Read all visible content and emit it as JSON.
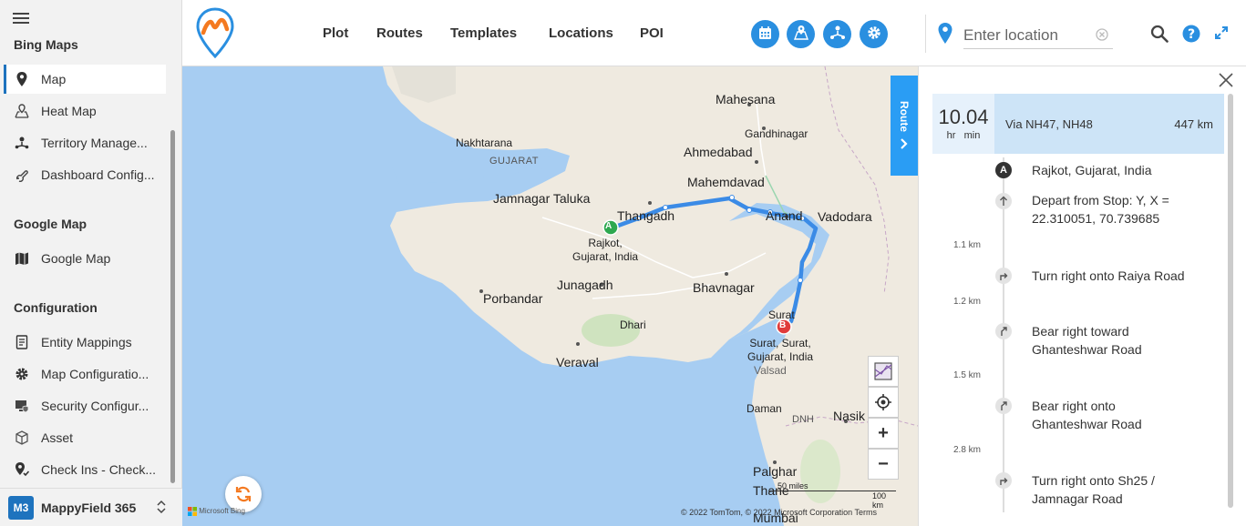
{
  "sidebar": {
    "sections": [
      {
        "title": "Bing Maps"
      },
      {
        "title": "Google Map"
      },
      {
        "title": "Configuration"
      }
    ],
    "items": [
      {
        "label": "Map"
      },
      {
        "label": "Heat Map"
      },
      {
        "label": "Territory Manage..."
      },
      {
        "label": "Dashboard Config..."
      },
      {
        "label": "Google Map"
      },
      {
        "label": "Entity Mappings"
      },
      {
        "label": "Map Configuratio..."
      },
      {
        "label": "Security Configur..."
      },
      {
        "label": "Asset"
      },
      {
        "label": "Check Ins - Check..."
      }
    ],
    "footer": {
      "avatar": "M3",
      "app_name": "MappyField 365"
    }
  },
  "topnav": {
    "items": [
      {
        "label": "Plot"
      },
      {
        "label": "Routes"
      },
      {
        "label": "Templates"
      },
      {
        "label": "Locations"
      },
      {
        "label": "POI"
      }
    ],
    "location_placeholder": "Enter location"
  },
  "map": {
    "cities": [
      {
        "name": "Mahesana"
      },
      {
        "name": "Gandhinagar"
      },
      {
        "name": "Ahmedabad"
      },
      {
        "name": "Nakhtarana"
      },
      {
        "name": "GUJARAT"
      },
      {
        "name": "Mahemdavad"
      },
      {
        "name": "Jamnagar Taluka"
      },
      {
        "name": "Thangadh"
      },
      {
        "name": "Anand"
      },
      {
        "name": "Vadodara"
      },
      {
        "name": "Junagadh"
      },
      {
        "name": "Bhavnagar"
      },
      {
        "name": "Porbandar"
      },
      {
        "name": "Dhari"
      },
      {
        "name": "Surat"
      },
      {
        "name": "Veraval"
      },
      {
        "name": "Valsad"
      },
      {
        "name": "Daman"
      },
      {
        "name": "DNH"
      },
      {
        "name": "Nasik"
      },
      {
        "name": "Palghar"
      },
      {
        "name": "Thane"
      },
      {
        "name": "Mumbai"
      }
    ],
    "pin_a": {
      "marker": "A",
      "label_line1": "Rajkot,",
      "label_line2": "Gujarat, India"
    },
    "pin_b": {
      "marker": "B",
      "label_line1": "Surat, Surat,",
      "label_line2": "Gujarat, India"
    },
    "route_tab": "Route",
    "bing_credit": "Microsoft Bing",
    "copyright": "© 2022 TomTom, © 2022 Microsoft Corporation  Terms",
    "scale_miles": "50 miles",
    "scale_km": "100 km",
    "zoom_in": "+",
    "zoom_out": "−",
    "route_color": "#3b8be6"
  },
  "route_panel": {
    "summary": {
      "time": "10.04",
      "time_units": "hr   min",
      "via": "Via NH47, NH48",
      "distance": "447 km"
    },
    "steps": [
      {
        "icon": "A",
        "text": "Rajkot, Gujarat, India",
        "dist": ""
      },
      {
        "icon": "depart",
        "text": "Depart from Stop: Y, X = 22.310051, 70.739685",
        "dist": "1.1 km"
      },
      {
        "icon": "turn-right",
        "text": "Turn right onto Raiya Road",
        "dist": "1.2 km"
      },
      {
        "icon": "bear-right",
        "text": "Bear right toward Ghanteshwar Road",
        "dist": "1.5 km"
      },
      {
        "icon": "bear-right",
        "text": "Bear right onto Ghanteshwar Road",
        "dist": "2.8 km"
      },
      {
        "icon": "turn-right",
        "text": "Turn right onto Sh25 / Jamnagar Road",
        "dist": ""
      }
    ]
  }
}
